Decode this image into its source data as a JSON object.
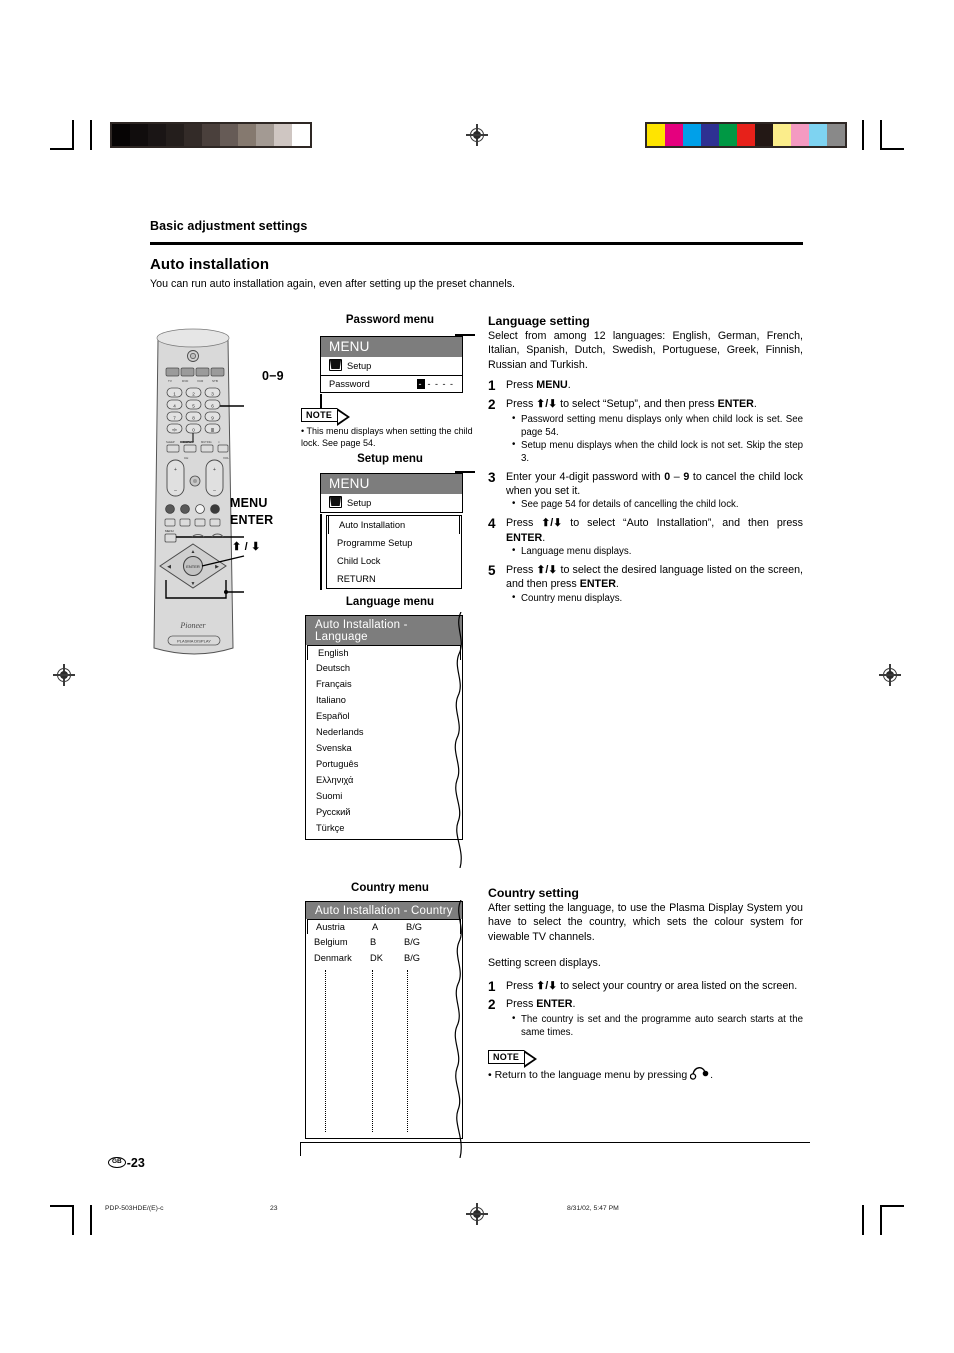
{
  "page": {
    "section_label": "Basic adjustment settings",
    "title": "Auto installation",
    "lead": "You can run auto installation again, even after setting up the preset channels.",
    "page_number": "-23",
    "region_badge": "GB",
    "footer_file": "PDP-503HDE/(E)-c",
    "footer_page": "23",
    "footer_date": "8/31/02, 5:47 PM"
  },
  "remote": {
    "brand": "Pioneer",
    "plasma_label": "PLASMA DISPLAY",
    "callouts": {
      "digits": "0−9",
      "menu": "MENU",
      "enter": "ENTER",
      "updown": "⬆ / ⬇"
    }
  },
  "password_menu": {
    "caption": "Password menu",
    "header": "MENU",
    "setup_row": "Setup",
    "password_label": "Password",
    "password_value": "- - - -",
    "note_badge": "NOTE",
    "note_text": "• This menu displays when setting the child lock. See page 54."
  },
  "setup_menu": {
    "caption": "Setup menu",
    "header": "MENU",
    "setup_row": "Setup",
    "items": [
      {
        "label": "Auto Installation",
        "selected": true
      },
      {
        "label": "Programme Setup",
        "selected": false
      },
      {
        "label": "Child Lock",
        "selected": false
      },
      {
        "label": "RETURN",
        "selected": false
      }
    ]
  },
  "language_menu": {
    "caption": "Language menu",
    "header": "Auto Installation - Language",
    "items": [
      {
        "label": "English",
        "selected": true
      },
      {
        "label": "Deutsch",
        "selected": false
      },
      {
        "label": "Français",
        "selected": false
      },
      {
        "label": "Italiano",
        "selected": false
      },
      {
        "label": "Español",
        "selected": false
      },
      {
        "label": "Nederlands",
        "selected": false
      },
      {
        "label": "Svenska",
        "selected": false
      },
      {
        "label": "Português",
        "selected": false
      },
      {
        "label": "Ελληνιχά",
        "selected": false
      },
      {
        "label": "Suomi",
        "selected": false
      },
      {
        "label": "Русский",
        "selected": false
      },
      {
        "label": "Türkçe",
        "selected": false
      }
    ]
  },
  "country_menu": {
    "caption": "Country menu",
    "header": "Auto Installation - Country",
    "rows": [
      {
        "country": "Austria",
        "code": "A",
        "system": "B/G",
        "selected": true
      },
      {
        "country": "Belgium",
        "code": "B",
        "system": "B/G",
        "selected": false
      },
      {
        "country": "Denmark",
        "code": "DK",
        "system": "B/G",
        "selected": false
      }
    ]
  },
  "language_setting": {
    "heading": "Language setting",
    "intro": "Select from among 12 languages: English, German, French, Italian, Spanish, Dutch, Swedish, Portuguese, Greek, Finnish, Russian and Turkish.",
    "steps": [
      {
        "num": "1",
        "text_html": "Press <b>MENU</b>.",
        "bullets": []
      },
      {
        "num": "2",
        "text_html": "Press <b>⬆/⬇</b> to select “Setup”, and then press <b>ENTER</b>.",
        "bullets": [
          "Password setting menu displays only when child lock is set. See page 54.",
          "Setup menu displays when the child lock is not set. Skip the step 3."
        ]
      },
      {
        "num": "3",
        "text_html": "Enter your 4-digit password with <b>0</b> – <b>9</b> to cancel the child lock when you set it.",
        "bullets": [
          "See page 54 for details of cancelling the child lock."
        ]
      },
      {
        "num": "4",
        "text_html": "Press <b>⬆/⬇</b> to select “Auto Installation”, and then press <b>ENTER</b>.",
        "bullets": [
          "Language menu displays."
        ]
      },
      {
        "num": "5",
        "text_html": "Press <b>⬆/⬇</b> to select the desired language listed on the screen, and then press <b>ENTER</b>.",
        "bullets": [
          "Country menu displays."
        ]
      }
    ]
  },
  "country_setting": {
    "heading": "Country setting",
    "intro": "After setting the language, to use the Plasma Display System you have to select the country, which sets the colour system for viewable TV channels.",
    "intro2": "Setting screen displays.",
    "steps": [
      {
        "num": "1",
        "text_html": "Press <b>⬆/⬇</b> to select your country or area listed on the screen.",
        "bullets": []
      },
      {
        "num": "2",
        "text_html": "Press <b>ENTER</b>.",
        "bullets": [
          "The country is set and the programme auto search starts at the same times."
        ]
      }
    ],
    "note_badge": "NOTE",
    "note_text": "• Return to the language menu by pressing"
  },
  "colors": {
    "grey_bar": [
      "#060404",
      "#110d0d",
      "#1a1515",
      "#241e1c",
      "#332b28",
      "#4a403c",
      "#665b56",
      "#85796f",
      "#a39a93",
      "#cfc6c2",
      "#ffffff"
    ],
    "color_bar": [
      "#ffe400",
      "#e5007e",
      "#00a0e9",
      "#2e3192",
      "#009844",
      "#e7211a",
      "#231815",
      "#fbed8b",
      "#f49ac1",
      "#7ed3f1",
      "#898989"
    ],
    "osd_header_grey": "#7d7d7d",
    "remote_body": "#d7d7d7"
  }
}
